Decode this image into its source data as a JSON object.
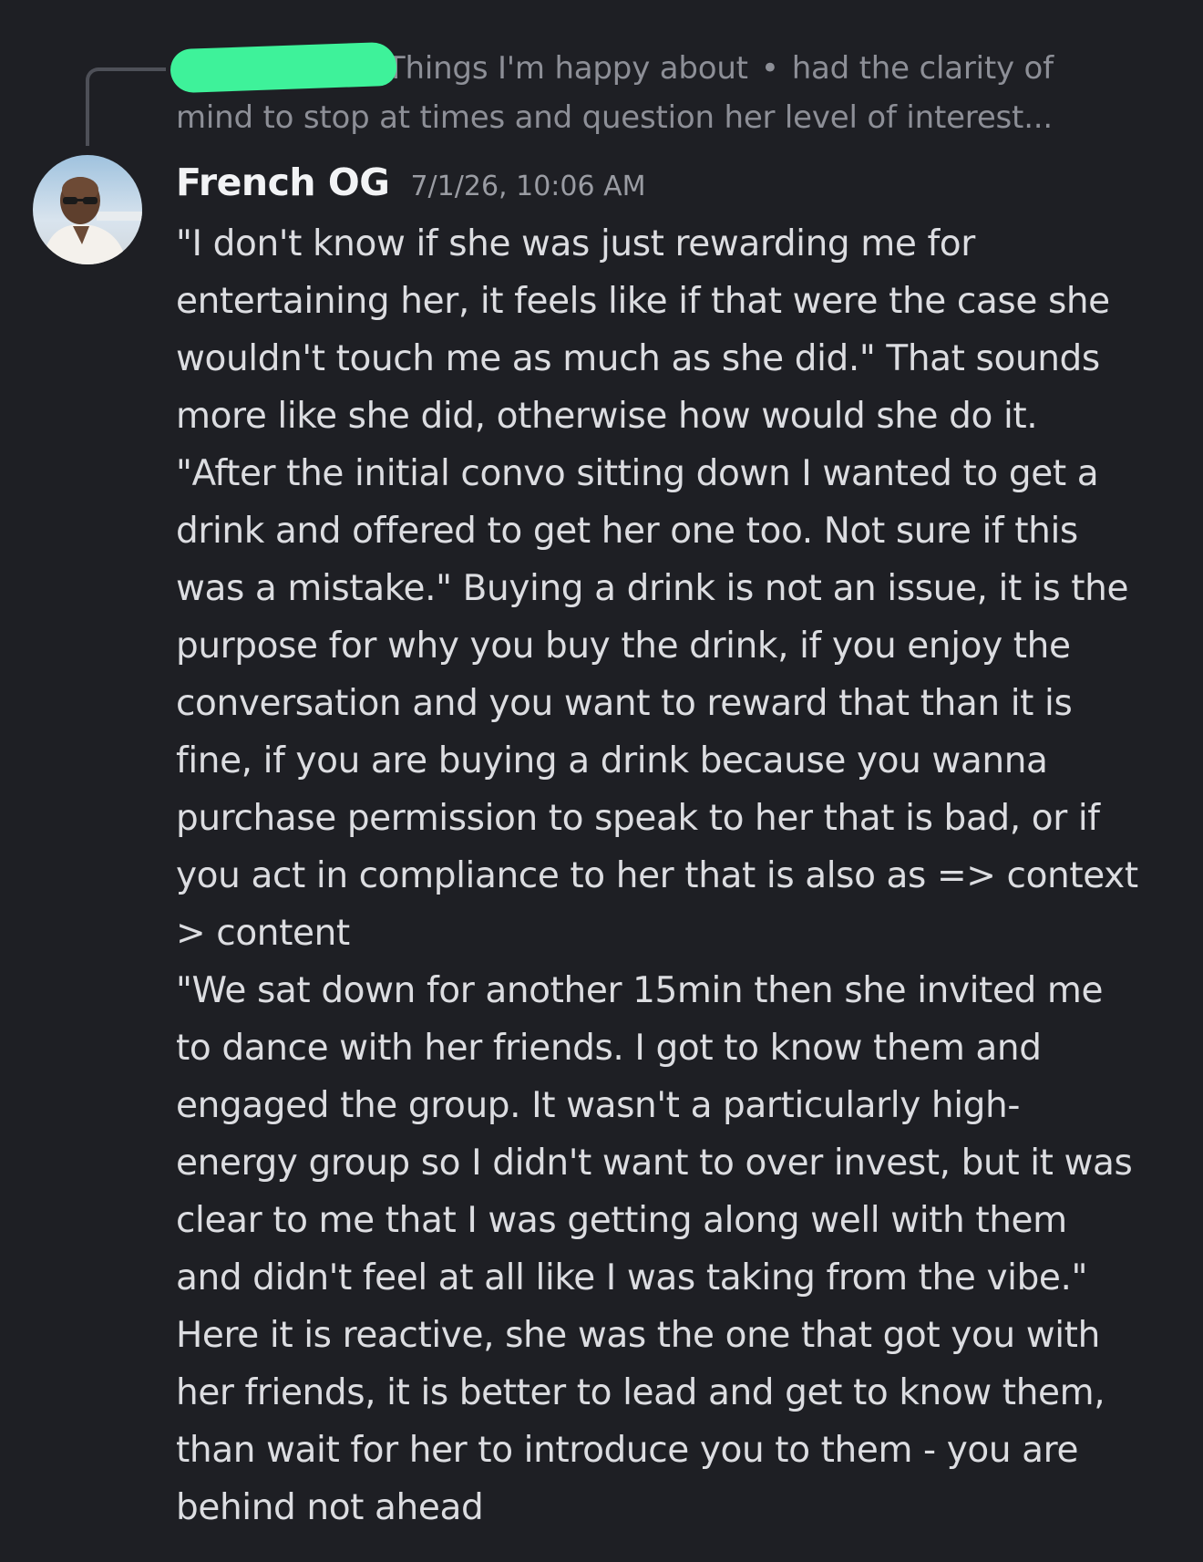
{
  "reply": {
    "channel": "Things I'm happy about",
    "separator": "•",
    "preview_line_1": "had the clarity of",
    "preview_line_2": "mind to stop at times and question her level of interest..."
  },
  "message": {
    "author": "French OG",
    "timestamp": "7/1/26, 10:06 AM",
    "lines": [
      "\"I don't know if she was just rewarding me for",
      "entertaining her, it feels like if that were the case she",
      "wouldn't touch me as much as she did.\" That sounds",
      "more like she did, otherwise how would she do it.",
      "\"After the initial convo sitting down I wanted to get a",
      "drink and offered to get her one too. Not sure if this",
      "was a mistake.\" Buying a drink is not an issue, it is the",
      "purpose for why you buy the drink, if you enjoy the",
      "conversation and you want to reward that than it is",
      "fine, if you are buying a drink because you wanna",
      "purchase permission to speak to her that is bad, or if",
      "you act in compliance to her that is also as => context",
      "> content",
      "\"We sat down for another 15min then she invited me",
      "to dance with her friends. I got to know them and",
      "engaged the group. It wasn't a particularly high-",
      "energy group so I didn't want to over invest, but it was",
      "clear to me that I was getting along well with them",
      "and didn't feel at all like I was taking from the vibe.\"",
      "Here it is reactive, she was the one that got you with",
      "her friends, it is better to lead and get to know them,",
      "than wait for her to introduce you to them - you are",
      "behind not ahead"
    ]
  },
  "colors": {
    "background": "#1e1f24",
    "redaction": "#3ef29a",
    "author": "#f2f3f5",
    "body_text": "#dcdde1",
    "muted_text": "#8d8f97"
  }
}
